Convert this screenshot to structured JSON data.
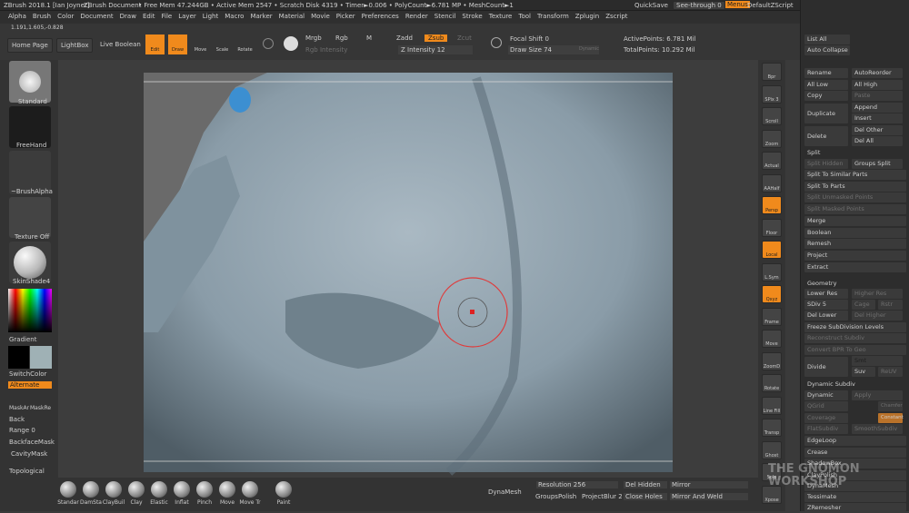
{
  "titlebar": {
    "app": "ZBrush 2018.1 [Ian Joyner]",
    "doc": "ZBrush Document",
    "stats": "• Free Mem 47.244GB • Active Mem 2547 • Scratch Disk 4319 • Timer►0.006 • PolyCount►6.781 MP • MeshCount►1",
    "quicksave": "QuickSave",
    "seethrough": "See-through 0",
    "menus": "Menus",
    "zscript": "DefaultZScript"
  },
  "menubar": [
    "Alpha",
    "Brush",
    "Color",
    "Document",
    "Draw",
    "Edit",
    "File",
    "Layer",
    "Light",
    "Macro",
    "Marker",
    "Material",
    "Movie",
    "Picker",
    "Preferences",
    "Render",
    "Stencil",
    "Stroke",
    "Texture",
    "Tool",
    "Transform",
    "Zplugin",
    "Zscript"
  ],
  "toolbar": {
    "coords": "1.191,1.605,-0.828",
    "home": "Home Page",
    "lightbox": "LightBox",
    "liveboolean": "Live Boolean",
    "edit": "Edit",
    "draw": "Draw",
    "move": "Move",
    "scale": "Scale",
    "rotate": "Rotate",
    "mrgb": "Mrgb",
    "rgb": "Rgb",
    "m": "M",
    "zadd": "Zadd",
    "zsub": "Zsub",
    "zcut": "Zcut",
    "rgb_intensity": "Rgb Intensity",
    "z_intensity": "Z Intensity 12",
    "focal_shift": "Focal Shift 0",
    "draw_size": "Draw Size 74",
    "dynamic": "Dynamic",
    "active_points": "ActivePoints: 6.781 Mil",
    "total_points": "TotalPoints: 10.292 Mil"
  },
  "leftshelf": {
    "standard": "Standard",
    "freehand": "FreeHand",
    "brushalpha": "~BrushAlpha",
    "texture_off": "Texture Off",
    "skinshade": "SkinShade4",
    "gradient": "Gradient",
    "switchcolor": "SwitchColor",
    "alternate": "Alternate",
    "maskar": "MaskAr",
    "maskre": "MaskRe",
    "back": "Back",
    "range": "Range 0",
    "backfacemask": "BackfaceMask",
    "cavitymask": "CavityMask",
    "topological": "Topological"
  },
  "rightshelf": [
    "Bpr",
    "SPix 3",
    "Scroll",
    "Zoom",
    "Actual",
    "AAHalf",
    "Persp",
    "Floor",
    "Local",
    "L.Sym",
    "Qxyz",
    "Frame",
    "Move",
    "ZoomD",
    "Rotate",
    "Line Fill PolyF",
    "Transp",
    "Ghost",
    "Solo",
    "Xpose"
  ],
  "panel": {
    "list_all": "List All",
    "auto_collapse": "Auto Collapse",
    "rename": "Rename",
    "autoreorder": "AutoReorder",
    "all_low": "All Low",
    "all_high": "All High",
    "copy": "Copy",
    "paste": "Paste",
    "duplicate": "Duplicate",
    "append": "Append",
    "insert": "Insert",
    "delete": "Delete",
    "del_other": "Del Other",
    "del_all": "Del All",
    "split": "Split",
    "split_hidden": "Split Hidden",
    "groups_split": "Groups Split",
    "split_similar": "Split To Similar Parts",
    "split_parts": "Split To Parts",
    "split_unmasked": "Split Unmasked Points",
    "split_masked": "Split Masked Points",
    "merge": "Merge",
    "boolean": "Boolean",
    "remesh": "Remesh",
    "project": "Project",
    "extract": "Extract",
    "geometry": "Geometry",
    "lower_res": "Lower Res",
    "higher_res": "Higher Res",
    "sdiv": "SDiv 5",
    "cage": "Cage",
    "rstr": "Rstr",
    "del_lower": "Del Lower",
    "del_higher": "Del Higher",
    "freeze": "Freeze SubDivision Levels",
    "reconstruct": "Reconstruct Subdiv",
    "convert_bpr": "Convert BPR To Geo",
    "divide": "Divide",
    "smt": "Smt",
    "suv": "Suv",
    "reuv": "ReUV",
    "dynamic_subdiv": "Dynamic Subdiv",
    "dynamic": "Dynamic",
    "apply": "Apply",
    "qgrid": "QGrid",
    "coverage": "Coverage",
    "chamfer": "Chamfer",
    "constant": "Constant",
    "flatsubdiv": "FlatSubdiv",
    "smoothsubdiv": "SmoothSubdiv",
    "edgeloop": "EdgeLoop",
    "crease": "Crease",
    "shadowbox": "ShadowBox",
    "claypolish": "ClayPolish",
    "dynamesh": "DynaMesh",
    "tessimate": "Tessimate",
    "zremesher": "ZRemesher"
  },
  "bottombar": {
    "brushes": [
      "Standar",
      "DamSta",
      "ClayBuil",
      "Clay",
      "Elastic",
      "Inflat",
      "Pinch",
      "Move",
      "Move Tr",
      "Paint"
    ],
    "dynamesh": "DynaMesh",
    "resolution": "Resolution 256",
    "groups": "Groups",
    "polish": "Polish",
    "project": "Project",
    "blur": "Blur 2",
    "del_hidden": "Del Hidden",
    "close_holes": "Close Holes",
    "mirror": "Mirror",
    "mirror_weld": "Mirror And Weld"
  },
  "watermark": "THE GNOMON WORKSHOP",
  "colors": {
    "accent": "#f08a1c",
    "model": "#8fa3b0",
    "brush_circle": "#e03a3a"
  }
}
